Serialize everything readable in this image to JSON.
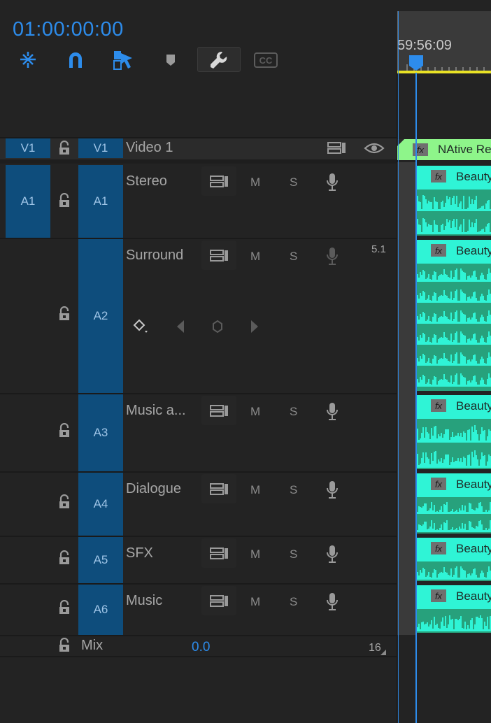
{
  "timecode": "01:00:00:00",
  "ruler": {
    "timecode": "59:56:09"
  },
  "toolbar": {
    "tools": [
      "insert-overwrite-sequences-icon",
      "snap-magnet-icon",
      "linked-selection-icon",
      "add-marker-icon",
      "timeline-settings-wrench-icon",
      "captions-cc-icon"
    ],
    "cc_label": "CC"
  },
  "video_track": {
    "source_label": "V1",
    "target_label": "V1",
    "name": "Video 1",
    "clip_label": "NAtive Re",
    "clip_fx": "fx"
  },
  "audio_tracks": [
    {
      "id": "a1",
      "source_label": "A1",
      "target_label": "A1",
      "name": "Stereo",
      "mute": "M",
      "solo": "S",
      "clip_label": "Beauty",
      "clip_fx": "fx",
      "channel_badge": ""
    },
    {
      "id": "a2",
      "source_label": "",
      "target_label": "A2",
      "name": "Surround",
      "mute": "M",
      "solo": "S",
      "clip_label": "Beauty",
      "clip_fx": "fx",
      "channel_badge": "5.1"
    },
    {
      "id": "a3",
      "source_label": "",
      "target_label": "A3",
      "name": "Music a...",
      "mute": "M",
      "solo": "S",
      "clip_label": "Beauty",
      "clip_fx": "fx",
      "channel_badge": ""
    },
    {
      "id": "a4",
      "source_label": "",
      "target_label": "A4",
      "name": "Dialogue",
      "mute": "M",
      "solo": "S",
      "clip_label": "Beauty",
      "clip_fx": "fx",
      "channel_badge": ""
    },
    {
      "id": "a5",
      "source_label": "",
      "target_label": "A5",
      "name": "SFX",
      "mute": "M",
      "solo": "S",
      "clip_label": "Beauty",
      "clip_fx": "fx",
      "channel_badge": ""
    },
    {
      "id": "a6",
      "source_label": "",
      "target_label": "A6",
      "name": "Music",
      "mute": "M",
      "solo": "S",
      "clip_label": "Beauty",
      "clip_fx": "fx",
      "channel_badge": ""
    }
  ],
  "mix": {
    "label": "Mix",
    "value": "0.0",
    "channels": "16"
  },
  "colors": {
    "accent": "#2d8ceb",
    "track_target": "#0e4d7c",
    "clip_audio": "#2ff4d6",
    "clip_video": "#8ef58a",
    "work_area": "#e9e225"
  }
}
